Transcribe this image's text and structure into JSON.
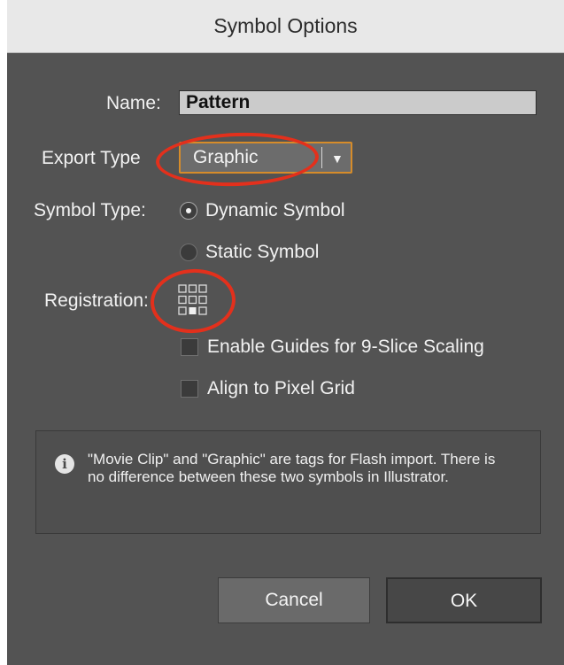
{
  "window": {
    "title": "Symbol Options"
  },
  "form": {
    "name_label": "Name:",
    "name_value": "Pattern",
    "export_type_label": "Export Type",
    "export_type_value": "Graphic",
    "symbol_type_label": "Symbol Type:",
    "symbol_type_options": [
      {
        "label": "Dynamic Symbol",
        "selected": true
      },
      {
        "label": "Static Symbol",
        "selected": false
      }
    ],
    "registration_label": "Registration:",
    "registration_selected": "bottom-center",
    "checkboxes": [
      {
        "label": "Enable Guides for 9-Slice Scaling",
        "checked": false
      },
      {
        "label": "Align to Pixel Grid",
        "checked": false
      }
    ]
  },
  "info": {
    "icon": "info-icon",
    "glyph": "i",
    "text": "\"Movie Clip\" and \"Graphic\" are tags for Flash import. There is no difference between these two symbols in Illustrator."
  },
  "buttons": {
    "cancel": "Cancel",
    "ok": "OK"
  },
  "colors": {
    "dialog_bg": "#535353",
    "titlebar_bg": "#e8e8e8",
    "focus_border": "#d68c2a",
    "annotation_red": "#e3301c"
  }
}
